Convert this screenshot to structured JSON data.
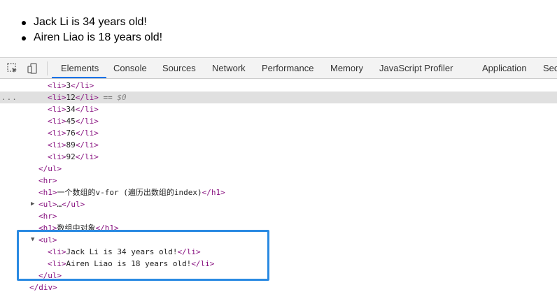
{
  "page": {
    "list": [
      "Jack Li is 34 years old!",
      "Airen Liao is 18 years old!"
    ]
  },
  "devtools": {
    "tabs": [
      {
        "label": "Elements",
        "active": true
      },
      {
        "label": "Console"
      },
      {
        "label": "Sources"
      },
      {
        "label": "Network"
      },
      {
        "label": "Performance"
      },
      {
        "label": "Memory"
      },
      {
        "label": "JavaScript Profiler"
      },
      {
        "label": "Application"
      },
      {
        "label": "Sec"
      }
    ],
    "icons": [
      "inspect-element-icon",
      "device-toolbar-icon"
    ],
    "accent_color": "#1a73e8",
    "highlight_color": "#2a8ae2"
  },
  "elements": {
    "lines": [
      {
        "open": "<li>",
        "text": "3",
        "close": "</li>"
      },
      {
        "open": "<li>",
        "text": "12",
        "close": "</li>",
        "suffix": " == ",
        "var": "$0",
        "selected": true
      },
      {
        "open": "<li>",
        "text": "34",
        "close": "</li>"
      },
      {
        "open": "<li>",
        "text": "45",
        "close": "</li>"
      },
      {
        "open": "<li>",
        "text": "76",
        "close": "</li>"
      },
      {
        "open": "<li>",
        "text": "89",
        "close": "</li>"
      },
      {
        "open": "<li>",
        "text": "92",
        "close": "</li>"
      },
      {
        "open": "</ul>",
        "text": "",
        "close": ""
      },
      {
        "open": "<hr>",
        "text": "",
        "close": ""
      },
      {
        "open": "<h1>",
        "text": "一个数组的v-for (遍历出数组的index)",
        "close": "</h1>"
      },
      {
        "open": "<ul>",
        "text": "…",
        "close": "</ul>",
        "collapsed": true
      },
      {
        "open": "<hr>",
        "text": "",
        "close": ""
      },
      {
        "open": "<h1>",
        "text": "数组中对象",
        "close": "</h1>"
      },
      {
        "open": "<ul>",
        "text": "",
        "close": "",
        "expanded": true
      },
      {
        "open": "<li>",
        "text": "Jack Li is 34 years old!",
        "close": "</li>"
      },
      {
        "open": "<li>",
        "text": "Airen Liao is 18 years old!",
        "close": "</li>"
      },
      {
        "open": "</ul>",
        "text": "",
        "close": ""
      },
      {
        "open": "</div>",
        "text": "",
        "close": ""
      }
    ],
    "selected_marker": "..."
  }
}
